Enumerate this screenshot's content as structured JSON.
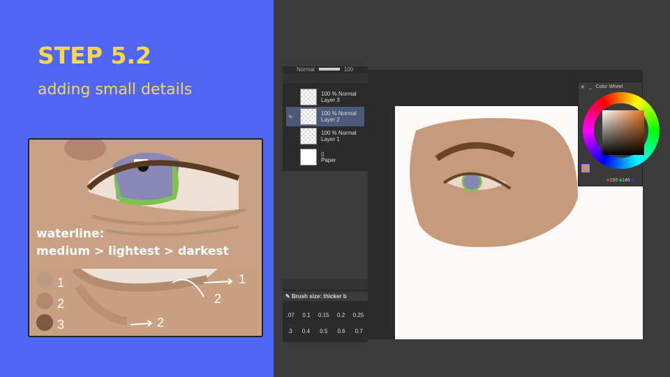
{
  "slide": {
    "title": "STEP 5.2",
    "subtitle": "adding small details"
  },
  "inset": {
    "caption_line1": "waterline:",
    "caption_line2": "medium > lightest > darkest",
    "swatch_labels": [
      "1",
      "2",
      "3"
    ],
    "arrow_labels": [
      "1",
      "2",
      "2"
    ],
    "swatch_colors": [
      "#bf9a82",
      "#b18a6e",
      "#7f5a42"
    ]
  },
  "app": {
    "blend_mode": "Normal",
    "opacity_top": "100",
    "layers": [
      {
        "opacity": "100 %",
        "mode": "Normal",
        "name": "Layer 3",
        "selected": false
      },
      {
        "opacity": "100 %",
        "mode": "Normal",
        "name": "Layer 2",
        "selected": true
      },
      {
        "opacity": "100 %",
        "mode": "Normal",
        "name": "Layer 1",
        "selected": false
      },
      {
        "name": "Paper"
      }
    ],
    "brush_label": "Brush size: thicker b",
    "brush_sizes_row1": [
      ".07",
      "0.1",
      "0.15",
      "0.2",
      "0.25"
    ],
    "brush_sizes_row2": [
      ".3",
      "0.4",
      "0.5",
      "0.6",
      "0.7"
    ],
    "color_wheel": {
      "title": "Color Wheel",
      "r": "193",
      "g": "146",
      "b": "",
      "current_color": "#c1926e"
    }
  }
}
